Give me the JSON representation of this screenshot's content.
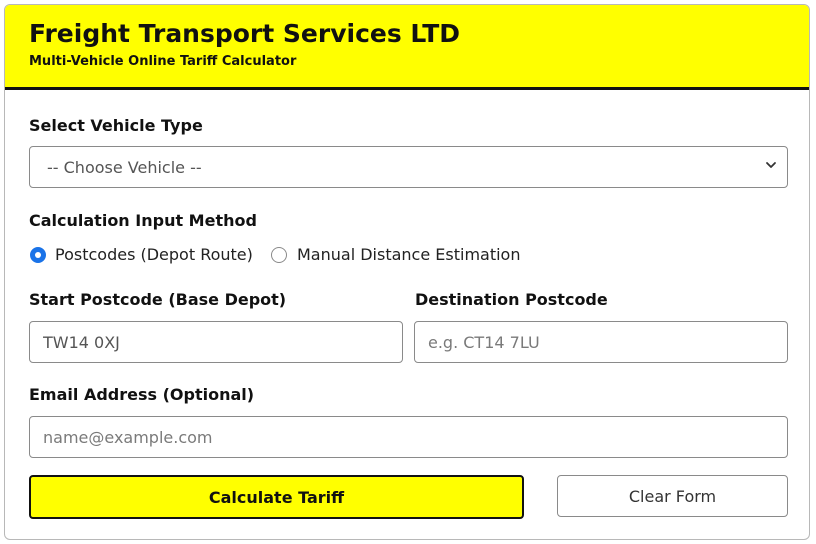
{
  "header": {
    "title": "Freight Transport Services LTD",
    "subtitle": "Multi-Vehicle Online Tariff Calculator"
  },
  "vehicle": {
    "label": "Select Vehicle Type",
    "selected": "-- Choose Vehicle --",
    "icon": "chevron-down-icon"
  },
  "method": {
    "label": "Calculation Input Method",
    "options": [
      {
        "label": "Postcodes (Depot Route)",
        "checked": true
      },
      {
        "label": "Manual Distance Estimation",
        "checked": false
      }
    ]
  },
  "start": {
    "label": "Start Postcode (Base Depot)",
    "value": "TW14 0XJ"
  },
  "destination": {
    "label": "Destination Postcode",
    "placeholder": "e.g. CT14 7LU"
  },
  "email": {
    "label": "Email Address (Optional)",
    "placeholder": "name@example.com"
  },
  "actions": {
    "calculate": "Calculate Tariff",
    "clear": "Clear Form"
  },
  "colors": {
    "accent": "#ffff00",
    "radio_checked": "#1a73e8"
  }
}
